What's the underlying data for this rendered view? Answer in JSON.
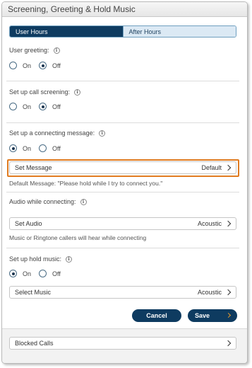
{
  "header": {
    "title": "Screening, Greeting & Hold Music"
  },
  "tabs": [
    {
      "label": "User Hours"
    },
    {
      "label": "After Hours"
    }
  ],
  "user_greeting": {
    "label": "User greeting:",
    "on": "On",
    "off": "Off",
    "selected": "Off"
  },
  "call_screening": {
    "label": "Set up call screening:",
    "on": "On",
    "off": "Off",
    "selected": "Off"
  },
  "connecting_message": {
    "label": "Set up a connecting message:",
    "on": "On",
    "off": "Off",
    "selected": "On",
    "button_label": "Set Message",
    "button_value": "Default",
    "help": "Default Message: \"Please hold while I try to connect you.\""
  },
  "audio_connecting": {
    "label": "Audio while connecting:",
    "button_label": "Set Audio",
    "button_value": "Acoustic",
    "help": "Music or Ringtone callers will hear while connecting"
  },
  "hold_music": {
    "label": "Set up hold music:",
    "on": "On",
    "off": "Off",
    "selected": "On",
    "button_label": "Select Music",
    "button_value": "Acoustic"
  },
  "actions": {
    "cancel": "Cancel",
    "save": "Save"
  },
  "blocked_calls": {
    "label": "Blocked Calls"
  },
  "icons": {
    "info": "info-icon",
    "chevron": "chevron-right-icon",
    "arrow": "arrow-right-icon"
  },
  "colors": {
    "primary": "#0e3b60",
    "highlight": "#e07b20",
    "tab_inactive": "#dbe9f4"
  }
}
